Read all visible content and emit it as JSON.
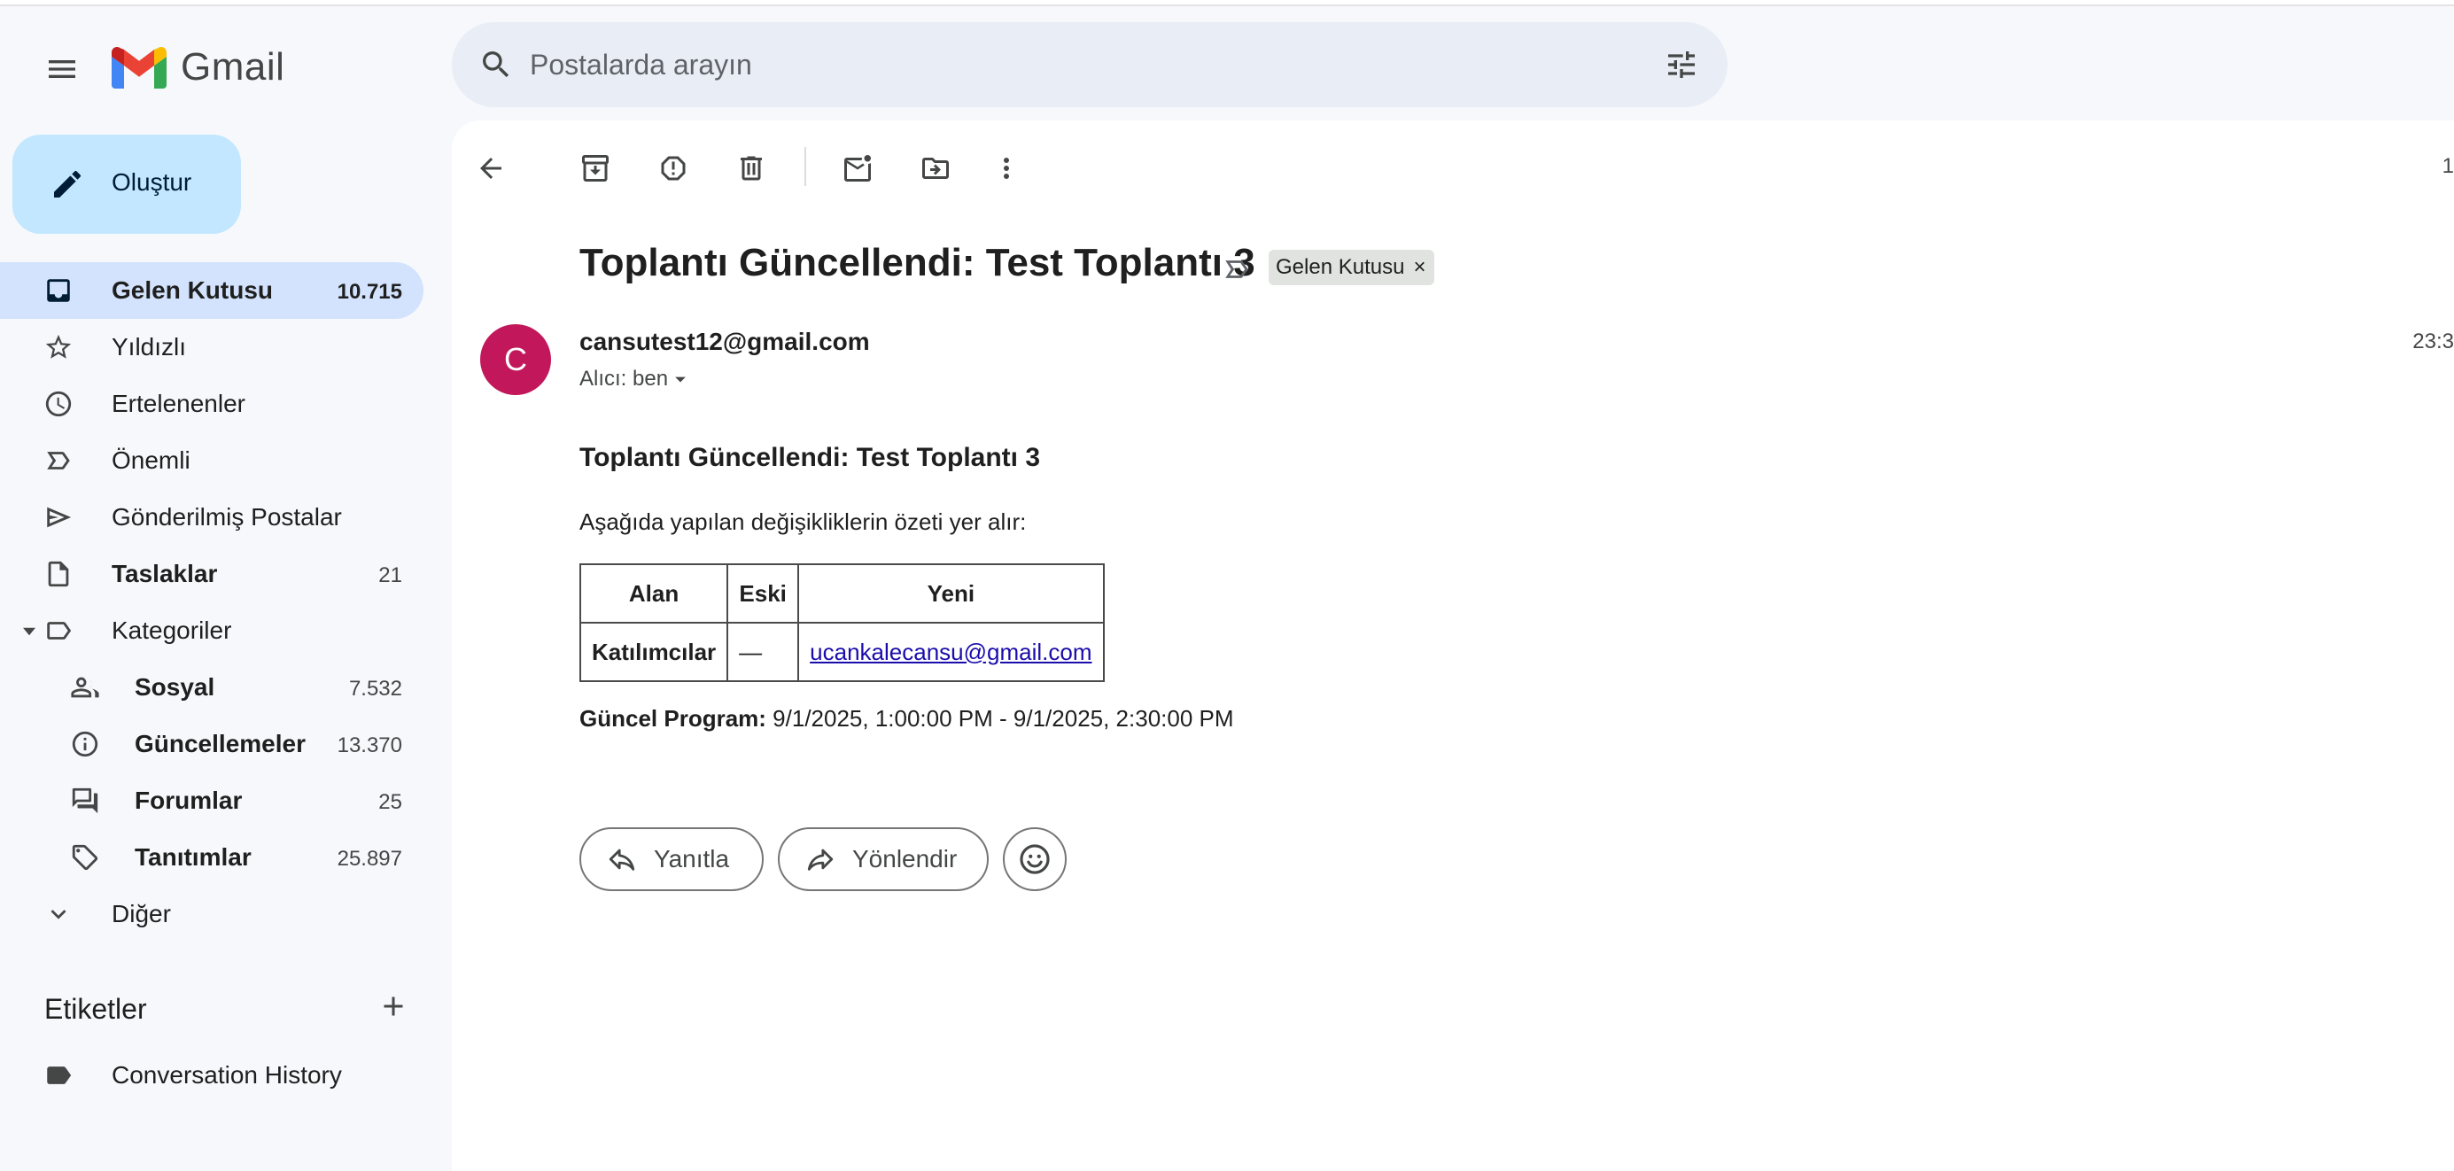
{
  "app": {
    "name": "Gmail"
  },
  "search": {
    "placeholder": "Postalarda arayın"
  },
  "compose": {
    "label": "Oluştur"
  },
  "nav": [
    {
      "label": "Gelen Kutusu",
      "count": "10.715",
      "icon": "inbox-icon"
    },
    {
      "label": "Yıldızlı",
      "count": "",
      "icon": "star-icon"
    },
    {
      "label": "Ertelenenler",
      "count": "",
      "icon": "clock-icon"
    },
    {
      "label": "Önemli",
      "count": "",
      "icon": "important-icon"
    },
    {
      "label": "Gönderilmiş Postalar",
      "count": "",
      "icon": "send-icon"
    },
    {
      "label": "Taslaklar",
      "count": "21",
      "icon": "draft-icon"
    },
    {
      "label": "Kategoriler",
      "count": "",
      "icon": "label-icon"
    }
  ],
  "categories": [
    {
      "label": "Sosyal",
      "count": "7.532",
      "icon": "people-icon"
    },
    {
      "label": "Güncellemeler",
      "count": "13.370",
      "icon": "info-icon"
    },
    {
      "label": "Forumlar",
      "count": "25",
      "icon": "forum-icon"
    },
    {
      "label": "Tanıtımlar",
      "count": "25.897",
      "icon": "tag-icon"
    }
  ],
  "more": {
    "label": "Diğer"
  },
  "labels": {
    "title": "Etiketler",
    "items": [
      {
        "label": "Conversation History"
      }
    ]
  },
  "toolbar": {
    "page_indicator": "1"
  },
  "email": {
    "subject": "Toplantı Güncellendi: Test Toplantı 3",
    "label_chip": "Gelen Kutusu",
    "chip_close": "×",
    "avatar_letter": "C",
    "avatar_color": "#c2185b",
    "sender": "cansutest12@gmail.com",
    "recipient": "Alıcı: ben",
    "timestamp": "23:3",
    "body_title": "Toplantı Güncellendi: Test Toplantı 3",
    "intro": "Aşağıda yapılan değişikliklerin özeti yer alır:",
    "table": {
      "headers": [
        "Alan",
        "Eski",
        "Yeni"
      ],
      "rows": [
        [
          "Katılımcılar",
          "—",
          "ucankalecansu@gmail.com"
        ]
      ]
    },
    "program_label": "Güncel Program:",
    "program_value": "9/1/2025, 1:00:00 PM - 9/1/2025, 2:30:00 PM"
  },
  "actions": {
    "reply": "Yanıtla",
    "forward": "Yönlendir"
  },
  "colors": {
    "accent": "#c2e7ff",
    "active_nav": "#d3e3fd",
    "background": "#f6f8fc"
  }
}
